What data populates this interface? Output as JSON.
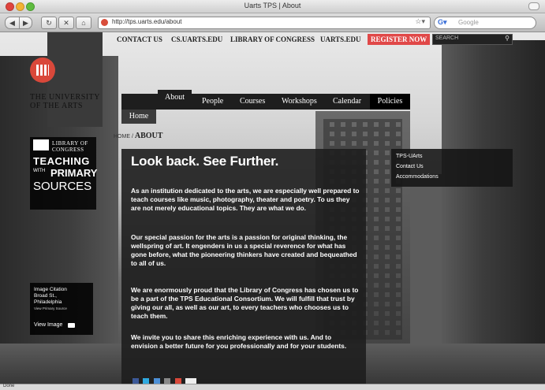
{
  "window": {
    "title": "Uarts TPS | About"
  },
  "browser": {
    "url": "http://tps.uarts.edu/about",
    "search_placeholder": "Google",
    "status": "Done"
  },
  "topnav": {
    "items": [
      "CONTACT US",
      "CS.UARTS.EDU",
      "LIBRARY OF CONGRESS",
      "UARTS.EDU"
    ],
    "register": "REGISTER NOW",
    "search_label": "SEARCH"
  },
  "logo": {
    "line1": "THE UNIVERSITY",
    "line2": "OF THE ARTS"
  },
  "loc_box": {
    "library": "LIBRARY OF",
    "congress": "CONGRESS",
    "teaching": "TEACHING",
    "with": "WITH",
    "primary": "PRIMARY",
    "sources": "SOURCES"
  },
  "mainnav": {
    "about": "About",
    "people": "People",
    "courses": "Courses",
    "workshops": "Workshops",
    "calendar": "Calendar",
    "policies": "Policies",
    "home": "Home"
  },
  "breadcrumb": {
    "home": "HOME /",
    "current": "ABOUT"
  },
  "content": {
    "heading": "Look back. See Further.",
    "p1": "As an institution dedicated to the arts, we are especially well prepared to teach courses like music, photography, theater and poetry. To us they are not merely educational topics. They are what we do.",
    "p2": "Our special passion for the arts is a passion for original thinking, the wellspring of art. It engenders in us a special reverence for what has gone before, what the pioneering thinkers have created and bequeathed to all of us.",
    "p3": "We are enormously proud that the Library of Congress has chosen us to be a part of the TPS Educational Consortium. We will fulfill that trust by giving our all, as well as our art, to every teachers who chooses us to teach them.",
    "p4": "We invite you to share this enriching experience with us. And to envision a better future for you professionally and for your students."
  },
  "submenu": [
    "TPS-UArts",
    "Contact Us",
    "Accommodations"
  ],
  "citation": {
    "title": "Image Citation",
    "place": "Broad St.,",
    "city": "Philadelphia",
    "source": "View Primary Source",
    "view": "View Image"
  },
  "colors": {
    "accent": "#e04848",
    "logo_red": "#d9483a",
    "panel": "#1e1e1e"
  }
}
